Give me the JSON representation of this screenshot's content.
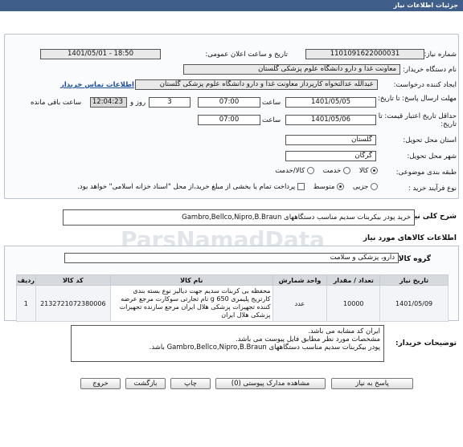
{
  "header": {
    "title": "جزئیات اطلاعات نیاز"
  },
  "fields": {
    "need_number_label": "شماره نیاز:",
    "need_number": "1101091622000031",
    "announce_label": "تاریخ و ساعت اعلان عمومی:",
    "announce_value": "1401/05/01 - 18:50",
    "buyer_org_label": "نام دستگاه خریدار:",
    "buyer_org": "معاونت غذا و دارو دانشگاه علوم پزشکی گلستان",
    "creator_label": "ایجاد کننده درخواست:",
    "creator": "عبدالله عدالتخواه کارپرداز معاونت غذا و دارو دانشگاه علوم پزشکی گلستان",
    "contact_link": "اطلاعات تماس خریدار",
    "deadline_label": "مهلت ارسال پاسخ: تا تاریخ:",
    "deadline_date": "1401/05/05",
    "time_label": "ساعت",
    "deadline_time": "07:00",
    "days_value": "3",
    "days_label": "روز و",
    "remaining_time": "12:04:23",
    "remaining_label": "ساعت باقی مانده",
    "validity_label": "حداقل تاریخ اعتبار قیمت: تا تاریخ:",
    "validity_date": "1401/05/06",
    "validity_time": "07:00",
    "province_label": "استان محل تحویل:",
    "province": "گلستان",
    "city_label": "شهر محل تحویل:",
    "city": "گرگان",
    "category_label": "طبقه بندی موضوعی:",
    "category_opt1": "کالا",
    "category_opt2": "خدمت",
    "category_opt3": "کالا/خدمت",
    "process_label": "نوع فرآیند خرید :",
    "process_opt1": "جزیی",
    "process_opt2": "متوسط",
    "process_note": "پرداخت تمام یا بخشی از مبلغ خرید،از محل \"اسناد خزانه اسلامی\" خواهد بود."
  },
  "summary": {
    "label": "شرح کلی نیاز:",
    "value": "خرید پودر بیکربنات سدیم مناسب دستگاههای Gambro,Bellco,Nipro,B.Braun"
  },
  "goods": {
    "title": "اطلاعات کالاهای مورد نیاز",
    "group_label": "گروه کالا:",
    "group_value": "دارو، پزشکی و سلامت"
  },
  "table": {
    "headers": [
      "ردیف",
      "کد کالا",
      "نام کالا",
      "واحد شمارش",
      "تعداد / مقدار",
      "تاریخ نیاز"
    ],
    "rows": [
      {
        "index": "1",
        "code": "2132721072380006",
        "name": "محفظه بی کربنات سدیم جهت دیالیز نوع بسته بندی کارتریج پلیمری 650 g نام تجارتی سوکارت مرجع عرضه کننده تجهیزات پزشکی هلال ایران مرجع سازنده تجهیزات پزشکی هلال ایران",
        "unit": "عدد",
        "qty": "10000",
        "date": "1401/05/09"
      }
    ]
  },
  "notes": {
    "label": "توضیحات خریدار:",
    "line1": "ایران کد مشابه می باشد.",
    "line2": "مشخصات مورد نظر مطابق فایل پیوست می باشد.",
    "line3": "پودر بیکربنات سدیم مناسب دستگاههای Gambro,Bellco,Nipro,B.Braun باشد."
  },
  "buttons": {
    "reply": "پاسخ به نیاز",
    "attachments": "مشاهده مدارک پیوستی (0)",
    "print": "چاپ",
    "back": "بازگشت",
    "exit": "خروج"
  },
  "watermark": {
    "brand": "ParsNamadData"
  }
}
